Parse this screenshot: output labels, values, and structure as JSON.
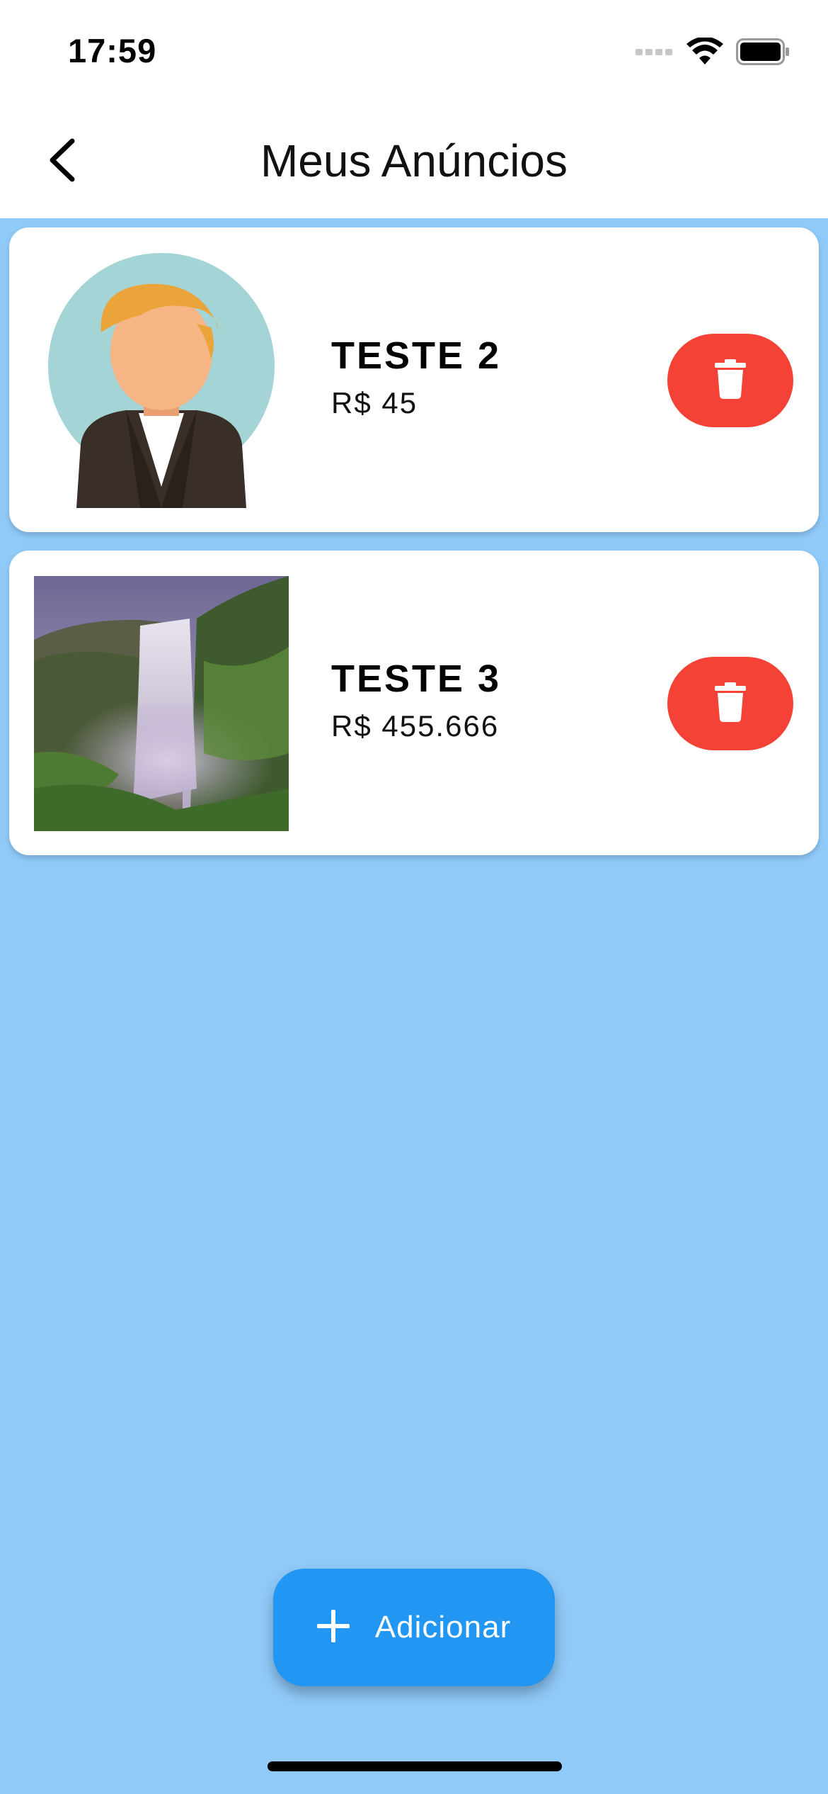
{
  "status_bar": {
    "time": "17:59",
    "icons": [
      "signal-icon",
      "wifi-icon",
      "battery-icon"
    ]
  },
  "nav": {
    "title": "Meus Anúncios",
    "back_icon": "chevron-left-icon"
  },
  "listings": [
    {
      "title": "TESTE 2",
      "price": "R$ 45",
      "image": "avatar-placeholder-image"
    },
    {
      "title": "TESTE 3",
      "price": "R$ 455.666",
      "image": "waterfall-photo"
    }
  ],
  "fab": {
    "label": "Adicionar",
    "icon": "plus-icon"
  },
  "colors": {
    "background": "#90CAF9",
    "delete": "#F44336",
    "primary": "#2196F3"
  }
}
